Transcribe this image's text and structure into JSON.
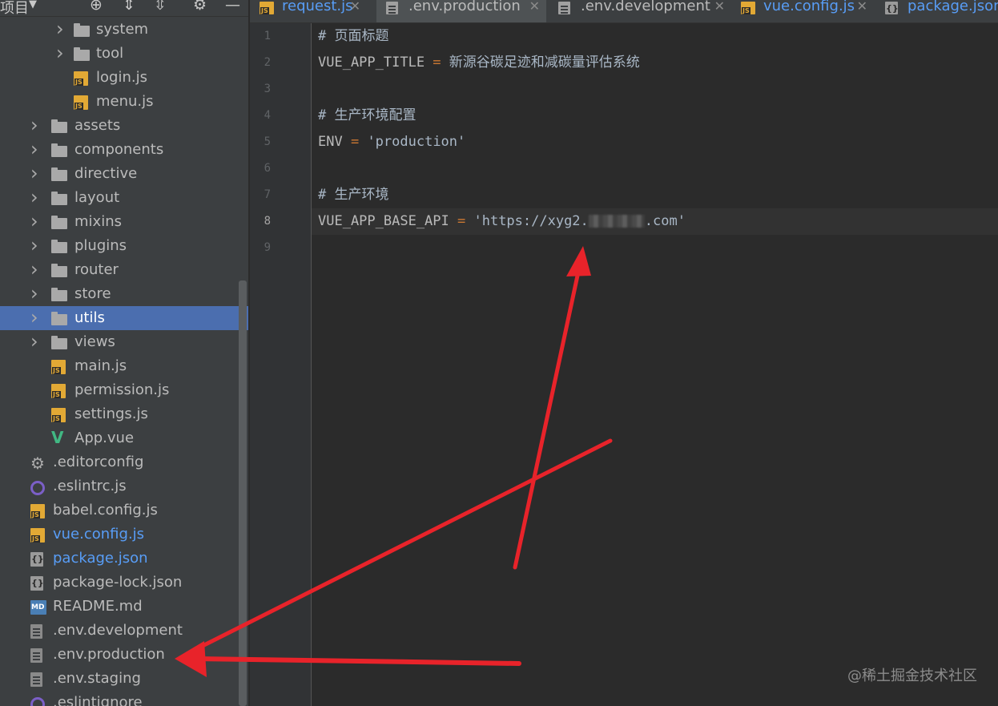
{
  "sidebar": {
    "header_title": "项目",
    "tree": [
      {
        "label": "system",
        "type": "folder",
        "depth": 2
      },
      {
        "label": "tool",
        "type": "folder",
        "depth": 2
      },
      {
        "label": "login.js",
        "type": "js",
        "depth": 2
      },
      {
        "label": "menu.js",
        "type": "js",
        "depth": 2
      },
      {
        "label": "assets",
        "type": "folder",
        "depth": 1
      },
      {
        "label": "components",
        "type": "folder",
        "depth": 1
      },
      {
        "label": "directive",
        "type": "folder",
        "depth": 1
      },
      {
        "label": "layout",
        "type": "folder",
        "depth": 1
      },
      {
        "label": "mixins",
        "type": "folder",
        "depth": 1
      },
      {
        "label": "plugins",
        "type": "folder",
        "depth": 1
      },
      {
        "label": "router",
        "type": "folder",
        "depth": 1
      },
      {
        "label": "store",
        "type": "folder",
        "depth": 1
      },
      {
        "label": "utils",
        "type": "folder",
        "depth": 1,
        "selected": true
      },
      {
        "label": "views",
        "type": "folder",
        "depth": 1
      },
      {
        "label": "main.js",
        "type": "js",
        "depth": 1
      },
      {
        "label": "permission.js",
        "type": "js",
        "depth": 1
      },
      {
        "label": "settings.js",
        "type": "js",
        "depth": 1
      },
      {
        "label": "App.vue",
        "type": "vue",
        "depth": 1
      },
      {
        "label": ".editorconfig",
        "type": "gear",
        "depth": 0
      },
      {
        "label": ".eslintrc.js",
        "type": "eslint",
        "depth": 0
      },
      {
        "label": "babel.config.js",
        "type": "js",
        "depth": 0
      },
      {
        "label": "vue.config.js",
        "type": "js",
        "depth": 0,
        "color": "#589df6"
      },
      {
        "label": "package.json",
        "type": "json",
        "depth": 0,
        "color": "#589df6"
      },
      {
        "label": "package-lock.json",
        "type": "json",
        "depth": 0
      },
      {
        "label": "README.md",
        "type": "md",
        "depth": 0
      },
      {
        "label": ".env.development",
        "type": "file",
        "depth": 0
      },
      {
        "label": ".env.production",
        "type": "file",
        "depth": 0
      },
      {
        "label": ".env.staging",
        "type": "file",
        "depth": 0
      },
      {
        "label": ".eslintignore",
        "type": "eslint",
        "depth": 0
      }
    ]
  },
  "tabs": [
    {
      "label": "request.js",
      "icon": "js",
      "color": "#589df6",
      "active": false
    },
    {
      "label": ".env.production",
      "icon": "file",
      "color": "#bbbbbb",
      "active": true
    },
    {
      "label": ".env.development",
      "icon": "file",
      "color": "#bbbbbb",
      "active": false
    },
    {
      "label": "vue.config.js",
      "icon": "js",
      "color": "#589df6",
      "active": false
    },
    {
      "label": "package.json",
      "icon": "json",
      "color": "#589df6",
      "active": false
    }
  ],
  "editor": {
    "current_line": 8,
    "lines": [
      {
        "n": "1",
        "kind": "comment",
        "text": "# 页面标题"
      },
      {
        "n": "2",
        "kind": "kv",
        "key": "VUE_APP_TITLE",
        "value": "新源谷碳足迹和减碳量评估系统"
      },
      {
        "n": "3",
        "kind": "blank"
      },
      {
        "n": "4",
        "kind": "comment",
        "text": "# 生产环境配置"
      },
      {
        "n": "5",
        "kind": "kv",
        "key": "ENV",
        "value": "'production'"
      },
      {
        "n": "6",
        "kind": "blank"
      },
      {
        "n": "7",
        "kind": "comment",
        "text": "# 生产环境"
      },
      {
        "n": "8",
        "kind": "kv",
        "key": "VUE_APP_BASE_API",
        "value_prefix": "'https://xyg2.",
        "value_suffix": ".com'"
      },
      {
        "n": "9",
        "kind": "blank"
      }
    ]
  },
  "watermark": "@稀土掘金技术社区",
  "annotation_color": "#e8232a"
}
